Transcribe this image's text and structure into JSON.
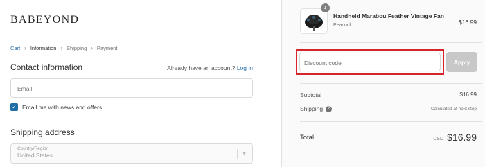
{
  "store": {
    "logo": "BABEYOND"
  },
  "breadcrumb": {
    "cart": "Cart",
    "information": "Information",
    "shipping": "Shipping",
    "payment": "Payment"
  },
  "contact": {
    "title": "Contact information",
    "account_prompt": "Already have an account?",
    "login_label": "Log in",
    "email_placeholder": "Email",
    "newsletter_label": "Email me with news and offers",
    "newsletter_checked": true
  },
  "shipping_address": {
    "title": "Shipping address",
    "country_label": "Country/Region",
    "country_value": "United States"
  },
  "order": {
    "product_name": "Handheld Marabou Feather Vintage Fan",
    "product_variant": "Peacock",
    "product_price": "$16.99",
    "quantity": "1",
    "discount_placeholder": "Discount code",
    "apply_label": "Apply",
    "subtotal_label": "Subtotal",
    "subtotal_value": "$16.99",
    "shipping_label": "Shipping",
    "shipping_value": "Calculated at next step",
    "total_label": "Total",
    "total_currency": "USD",
    "total_value": "$16.99"
  },
  "icons": {
    "checkbox": "checkmark-icon",
    "help": "question-circle-icon",
    "select": "chevron-down-icon",
    "breadcrumb_sep": "chevron-right-icon"
  },
  "colors": {
    "link": "#2a6fa8",
    "checkbox": "#1f6ea5",
    "highlight": "#d6242c",
    "apply_disabled": "#c8c8c8"
  }
}
